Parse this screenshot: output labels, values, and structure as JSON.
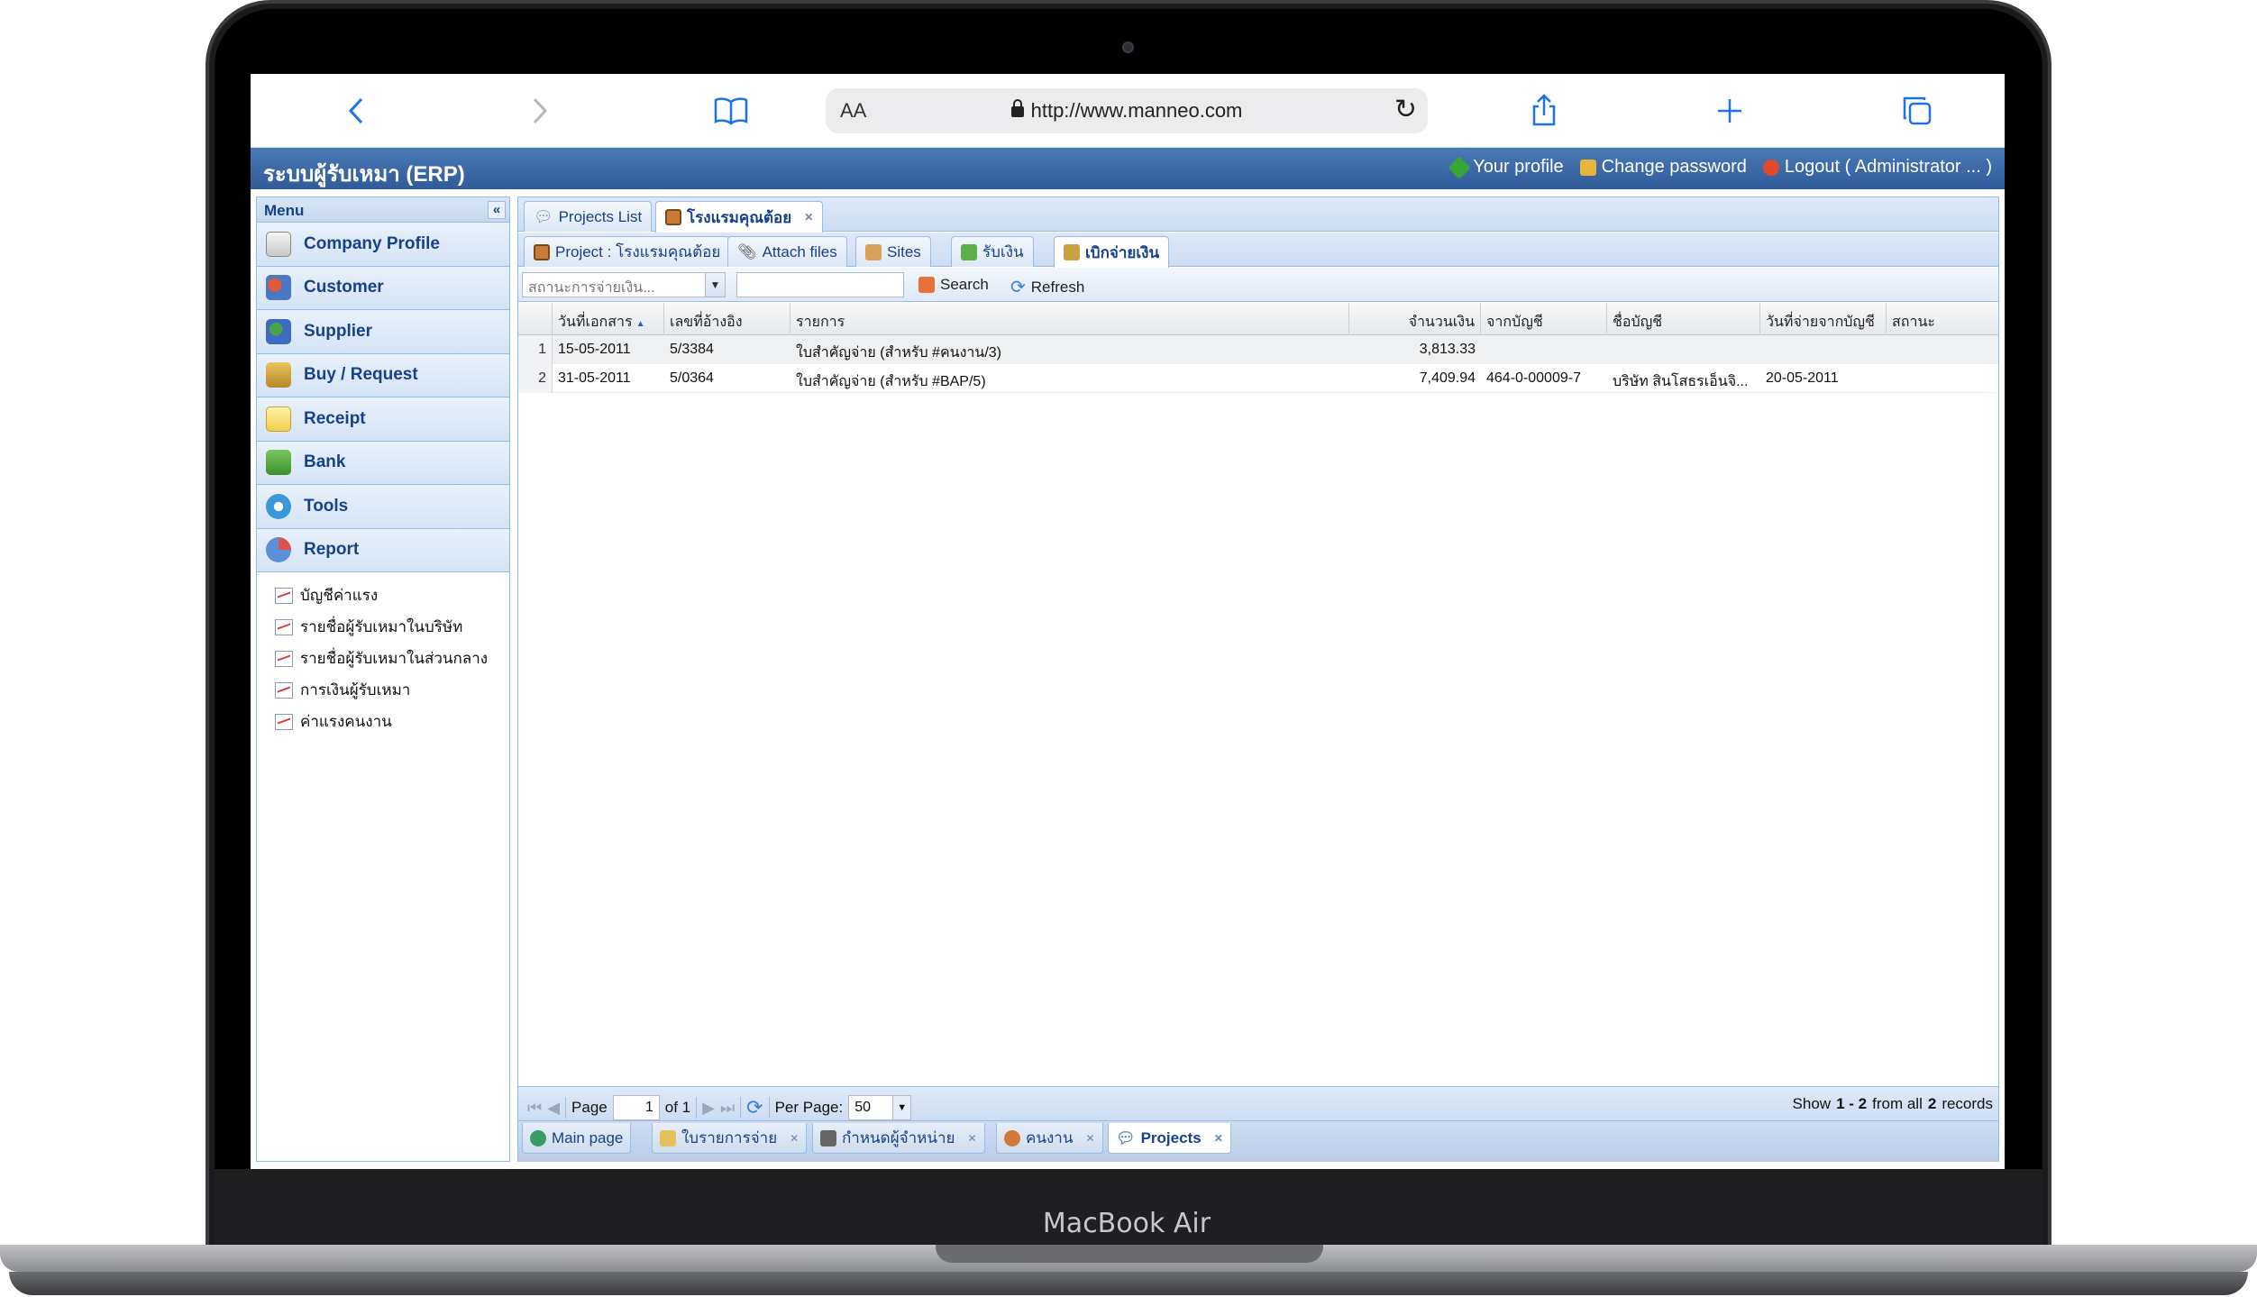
{
  "device": {
    "label": "MacBook Air"
  },
  "browser": {
    "aa_label": "AA",
    "url": "http://www.manneo.com"
  },
  "erp": {
    "title": "ระบบผู้รับเหมา (ERP)",
    "links": {
      "profile": "Your profile",
      "change_password": "Change password",
      "logout": "Logout ( Administrator ... )"
    }
  },
  "sidebar": {
    "header": "Menu",
    "items": [
      {
        "label": "Company Profile"
      },
      {
        "label": "Customer"
      },
      {
        "label": "Supplier"
      },
      {
        "label": "Buy / Request"
      },
      {
        "label": "Receipt"
      },
      {
        "label": "Bank"
      },
      {
        "label": "Tools"
      },
      {
        "label": "Report"
      }
    ],
    "reports": [
      "บัญชีค่าแรง",
      "รายชื่อผู้รับเหมาในบริษัท",
      "รายชื่อผู้รับเหมาในส่วนกลาง",
      "การเงินผู้รับเหมา",
      "ค่าแรงคนงาน"
    ]
  },
  "tabs": {
    "top": [
      "Projects List",
      "โรงแรมคุณต้อย"
    ],
    "sub": [
      "Project : โรงแรมคุณต้อย",
      "Attach files",
      "Sites",
      "รับเงิน",
      "เบิกจ่ายเงิน"
    ]
  },
  "toolbar": {
    "status_placeholder": "สถานะการจ่ายเงิน...",
    "search_label": "Search",
    "refresh_label": "Refresh"
  },
  "grid": {
    "columns": [
      "วันที่เอกสาร",
      "เลขที่อ้างอิง",
      "รายการ",
      "จำนวนเงิน",
      "จากบัญชี",
      "ชื่อบัญชี",
      "วันที่จ่ายจากบัญชี",
      "สถานะ"
    ],
    "rows": [
      {
        "num": "1",
        "date": "15-05-2011",
        "ref": "5/3384",
        "item": "ใบสำคัญจ่าย (สำหรับ #คนงาน/3)",
        "amount": "3,813.33",
        "from_account": "",
        "account_name": "",
        "paid_date": "",
        "status": ""
      },
      {
        "num": "2",
        "date": "31-05-2011",
        "ref": "5/0364",
        "item": "ใบสำคัญจ่าย (สำหรับ #BAP/5)",
        "amount": "7,409.94",
        "from_account": "464-0-00009-7",
        "account_name": "บริษัท สินโสธรเอ็นจิ...",
        "paid_date": "20-05-2011",
        "status": ""
      }
    ]
  },
  "pager": {
    "page_label": "Page",
    "page_value": "1",
    "of_label": "of 1",
    "per_page_label": "Per Page:",
    "per_page_value": "50",
    "show_prefix": "Show",
    "range": "1 - 2",
    "from_all": "from all",
    "total": "2",
    "records": "records"
  },
  "bottom_tabs": [
    "Main page",
    "ใบรายการจ่าย",
    "กำหนดผู้จำหน่าย",
    "คนงาน",
    "Projects"
  ]
}
